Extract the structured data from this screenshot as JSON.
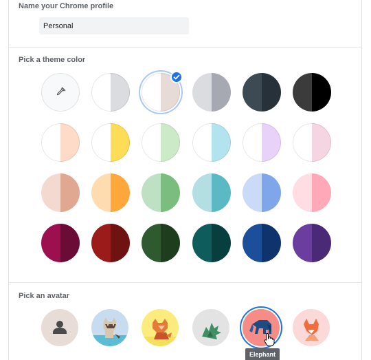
{
  "profile_name": {
    "title": "Name your Chrome profile",
    "value": "Personal"
  },
  "theme": {
    "title": "Pick a theme color",
    "picker_icon": "eyedropper-icon",
    "selected_index": 2,
    "check_icon": "checkmark-icon",
    "colors": [
      {
        "left": "#ffffff",
        "right": "#f1f3f4"
      },
      {
        "left": "#ffffff",
        "right": "#dadce0"
      },
      {
        "left": "#ffffff",
        "right": "#e6dbd7"
      },
      {
        "left": "#dadce0",
        "right": "#a6a9b1"
      },
      {
        "left": "#3c4a54",
        "right": "#27313a"
      },
      {
        "left": "#3b3b3b",
        "right": "#000000"
      },
      {
        "left": "#ffffff",
        "right": "#fddbc8"
      },
      {
        "left": "#ffffff",
        "right": "#fddc57"
      },
      {
        "left": "#ffffff",
        "right": "#cdeac8"
      },
      {
        "left": "#ffffff",
        "right": "#b3e3ef"
      },
      {
        "left": "#ffffff",
        "right": "#e8d2f9"
      },
      {
        "left": "#ffffff",
        "right": "#f6d5e2"
      },
      {
        "left": "#f3d9d0",
        "right": "#e0a791"
      },
      {
        "left": "#ffdbb0",
        "right": "#ffa73b"
      },
      {
        "left": "#bfe1c3",
        "right": "#7bbd7f"
      },
      {
        "left": "#b3dfe3",
        "right": "#5ab9c2"
      },
      {
        "left": "#c9dbf7",
        "right": "#7ea6e8"
      },
      {
        "left": "#ffdde3",
        "right": "#ffa9b8"
      },
      {
        "left": "#9d1050",
        "right": "#6a0c36"
      },
      {
        "left": "#9b1b1b",
        "right": "#6e1212"
      },
      {
        "left": "#2f5a2f",
        "right": "#1d3d1d"
      },
      {
        "left": "#0f5c5c",
        "right": "#073f3f"
      },
      {
        "left": "#1b4f99",
        "right": "#0f336d"
      },
      {
        "left": "#6a3d9f",
        "right": "#4a2977"
      }
    ]
  },
  "avatar": {
    "title": "Pick an avatar",
    "selected_index": 4,
    "items": [
      {
        "name": "person-icon",
        "bg": "#e8dcd7"
      },
      {
        "name": "origami-cat-icon",
        "bg": "#c7ddef"
      },
      {
        "name": "origami-fox-icon",
        "bg": "#fbec7d"
      },
      {
        "name": "origami-dragon-icon",
        "bg": "#e3e3e3"
      },
      {
        "name": "origami-elephant-icon",
        "bg": "#f58d86"
      },
      {
        "name": "origami-fox2-icon",
        "bg": "#fbd9d9"
      }
    ],
    "tooltip": "Elephant"
  },
  "accent_color": "#1a73e8"
}
